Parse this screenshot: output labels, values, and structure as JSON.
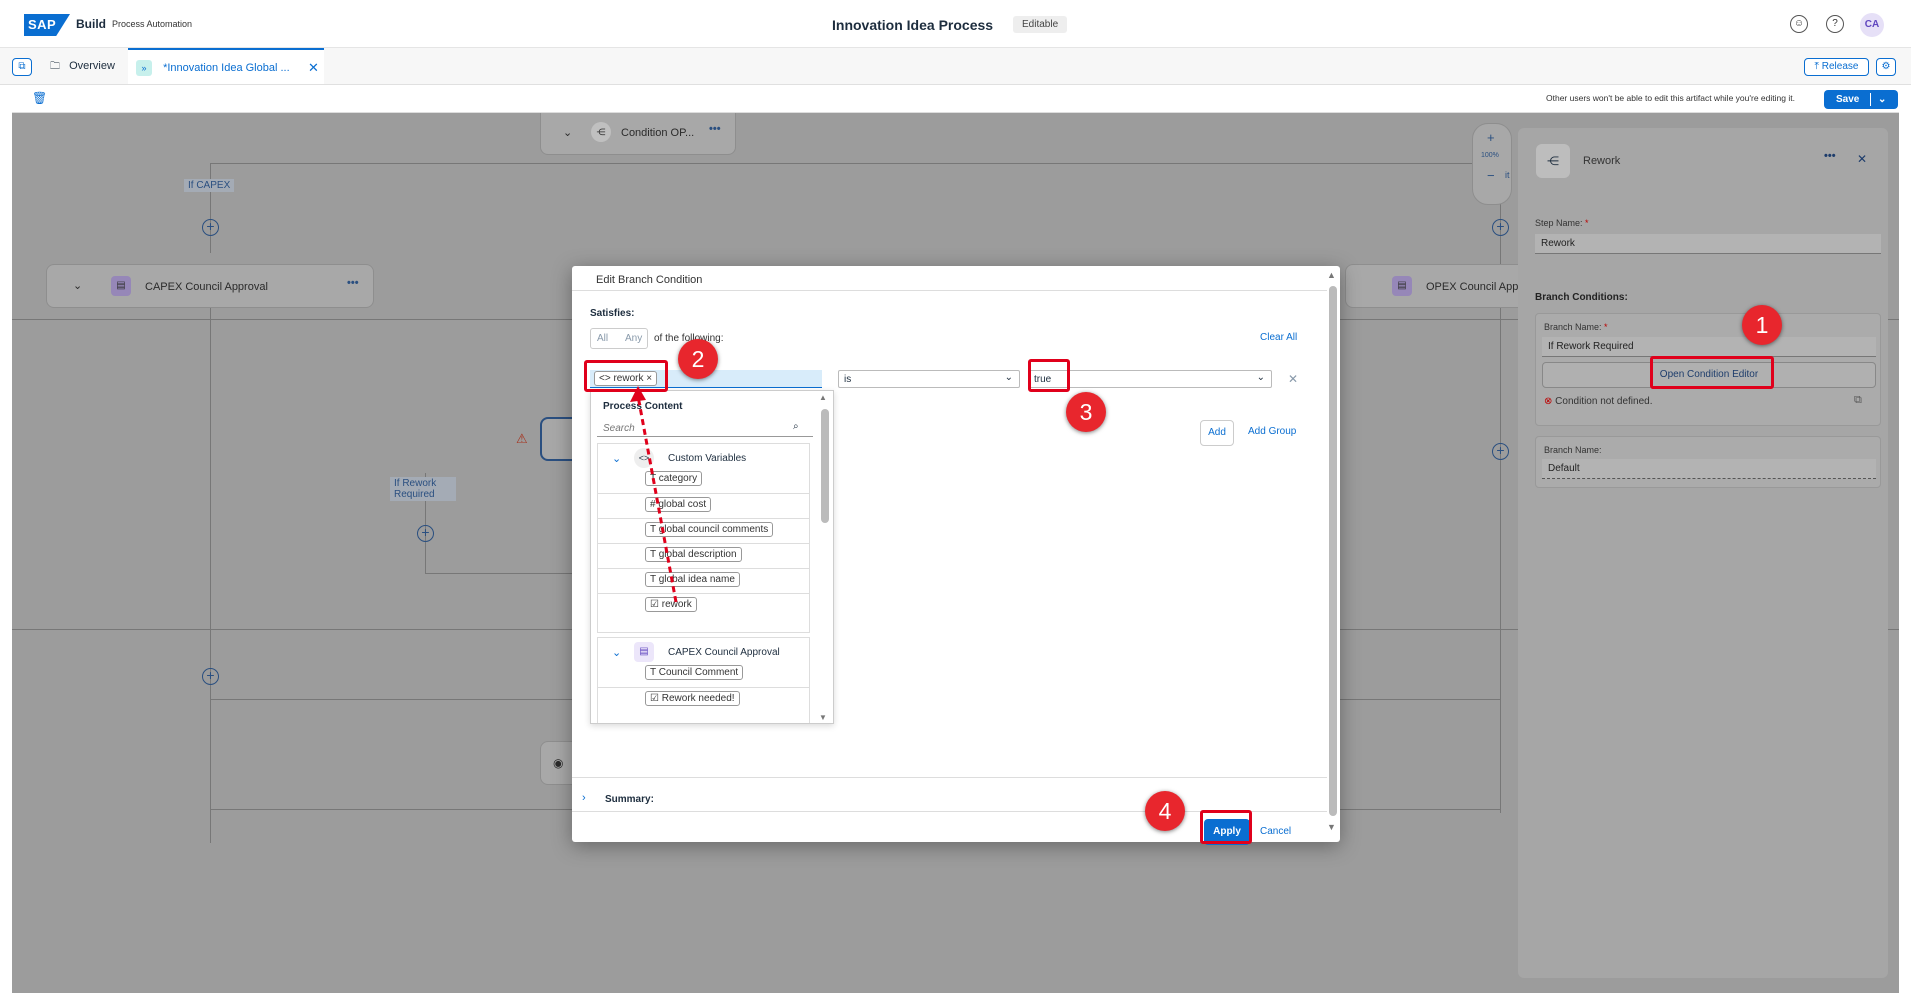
{
  "shell": {
    "logo": "SAP",
    "product": "Build",
    "subproduct": "Process Automation",
    "title": "Innovation Idea Process",
    "status": "Editable",
    "avatar": "CA"
  },
  "tabs": {
    "overview": "Overview",
    "active": "*Innovation Idea Global ...",
    "release": "Release"
  },
  "toolbar": {
    "lock_notice": "Other users won't be able to edit this artifact while you're editing it.",
    "save": "Save"
  },
  "canvas": {
    "condition_node": "Condition OP...",
    "capex_label": "If CAPEX",
    "capex_node": "CAPEX Council Approval",
    "opex_node": "OPEX Council Approv",
    "rework_label_line1": "If Rework",
    "rework_label_line2": "Required",
    "zoom": "100%",
    "fit": "it"
  },
  "panel": {
    "title": "Rework",
    "step_name_label": "Step Name:",
    "step_name_value": "Rework",
    "branch_conditions": "Branch Conditions:",
    "branch_name_label": "Branch Name:",
    "branch1_value": "If Rework Required",
    "open_editor": "Open Condition Editor",
    "not_defined": "Condition not defined.",
    "branch2_label": "Branch Name:",
    "branch2_value": "Default"
  },
  "dialog": {
    "title": "Edit Branch Condition",
    "satisfies": "Satisfies:",
    "all": "All",
    "any": "Any",
    "of_following": "of the following:",
    "clear_all": "Clear All",
    "token": "rework",
    "operator": "is",
    "value": "true",
    "add": "Add",
    "add_group": "Add Group",
    "process_content": "Process Content",
    "search_placeholder": "Search",
    "group1": "Custom Variables",
    "group1_items": [
      "category",
      "global cost",
      "global council comments",
      "global description",
      "global idea name",
      "rework"
    ],
    "group2": "CAPEX Council Approval",
    "group2_items": [
      "Council Comment",
      "Rework needed!"
    ],
    "summary": "Summary:",
    "apply": "Apply",
    "cancel": "Cancel"
  },
  "annotations": [
    "1",
    "2",
    "3",
    "4"
  ]
}
